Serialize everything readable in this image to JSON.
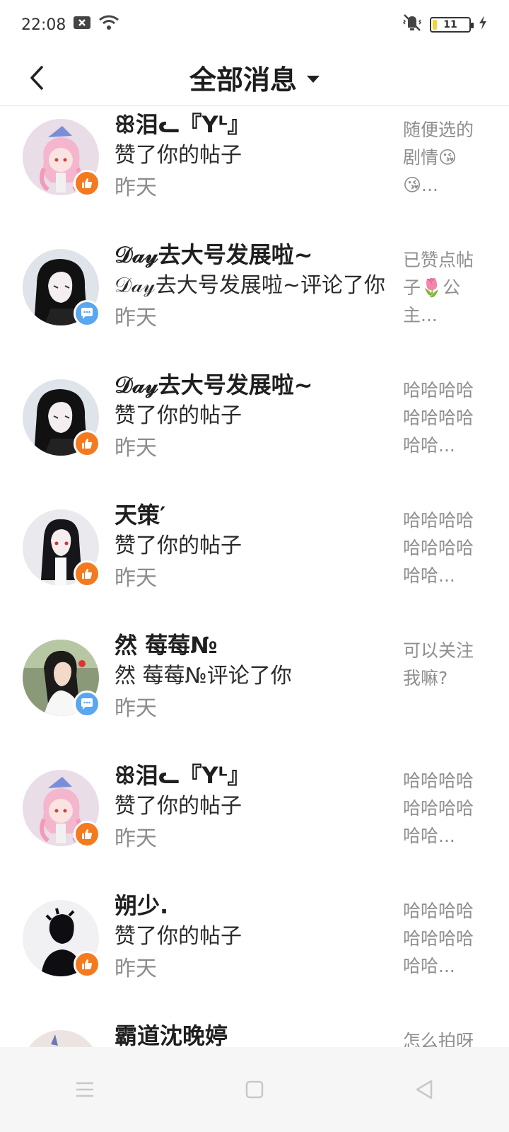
{
  "status_bar": {
    "time": "22:08",
    "battery": "11",
    "battery_level": 0.11
  },
  "header": {
    "title": "全部消息"
  },
  "messages": [
    {
      "name": "ꕥ泪ᓚ『Yᴸ』",
      "action": "赞了你的帖子",
      "time": "昨天",
      "preview": "随便选的剧情😘😘...",
      "type": "like",
      "avatar": "pink-anime"
    },
    {
      "name": "𝒟𝒶𝓎去大号发展啦~",
      "action": "𝒟𝒶𝓎去大号发展啦~评论了你",
      "time": "昨天",
      "preview": "已赞点帖子🌷公主...",
      "type": "comment",
      "avatar": "dark-anime"
    },
    {
      "name": "𝒟𝒶𝓎去大号发展啦~",
      "action": "赞了你的帖子",
      "time": "昨天",
      "preview": "哈哈哈哈哈哈哈哈哈哈...",
      "type": "like",
      "avatar": "dark-anime"
    },
    {
      "name": "天策′",
      "action": "赞了你的帖子",
      "time": "昨天",
      "preview": "哈哈哈哈哈哈哈哈哈哈...",
      "type": "like",
      "avatar": "black-hair-anime"
    },
    {
      "name": "然 莓莓№",
      "action": "然 莓莓№评论了你",
      "time": "昨天",
      "preview": "可以关注我嘛?",
      "type": "comment",
      "avatar": "photo-girl"
    },
    {
      "name": "ꕥ泪ᓚ『Yᴸ』",
      "action": "赞了你的帖子",
      "time": "昨天",
      "preview": "哈哈哈哈哈哈哈哈哈哈...",
      "type": "like",
      "avatar": "pink-anime"
    },
    {
      "name": "朔少.",
      "action": "赞了你的帖子",
      "time": "昨天",
      "preview": "哈哈哈哈哈哈哈哈哈哈...",
      "type": "like",
      "avatar": "silhouette"
    },
    {
      "name": "霸道沈晚婷",
      "action": "",
      "time": "",
      "preview": "怎么拍呀",
      "type": "like",
      "avatar": "partial"
    }
  ],
  "colors": {
    "like_badge": "#f47a20",
    "comment_badge": "#5aa6f0"
  }
}
